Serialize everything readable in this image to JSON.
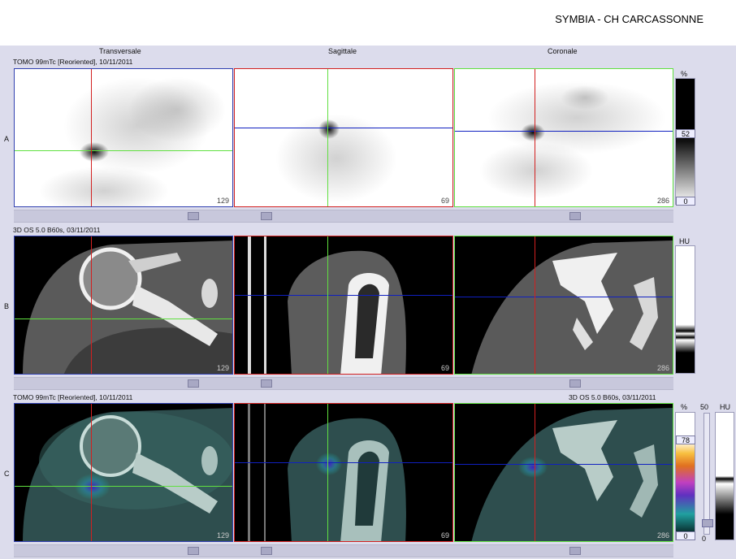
{
  "header": {
    "site": "SYMBIA - CH CARCASSONNE"
  },
  "columns": [
    "Transversale",
    "Sagittale",
    "Coronale"
  ],
  "rows": [
    {
      "label": "A",
      "series": "TOMO 99mTc [Reoriented], 10/11/2011"
    },
    {
      "label": "B",
      "series": "3D  OS  5.0  B60s, 03/11/2011"
    },
    {
      "label": "C",
      "series_left": "TOMO 99mTc [Reoriented], 10/11/2011",
      "series_right": "3D  OS  5.0  B60s, 03/11/2011"
    }
  ],
  "slices": {
    "transversal": "129",
    "sagittal": "69",
    "coronal": "286"
  },
  "scales": {
    "a": {
      "unit": "%",
      "value": "52",
      "min": "0"
    },
    "b": {
      "unit": "HU"
    },
    "c": {
      "unit": "%",
      "value": "78",
      "min": "0",
      "fusion_max": "50",
      "fusion_unit": "HU",
      "fusion_min": "0"
    }
  },
  "colors": {
    "crosshair_red": "#d22020",
    "crosshair_green": "#60e040",
    "crosshair_blue": "#1020c0",
    "frame_blue": "#3040b0"
  }
}
